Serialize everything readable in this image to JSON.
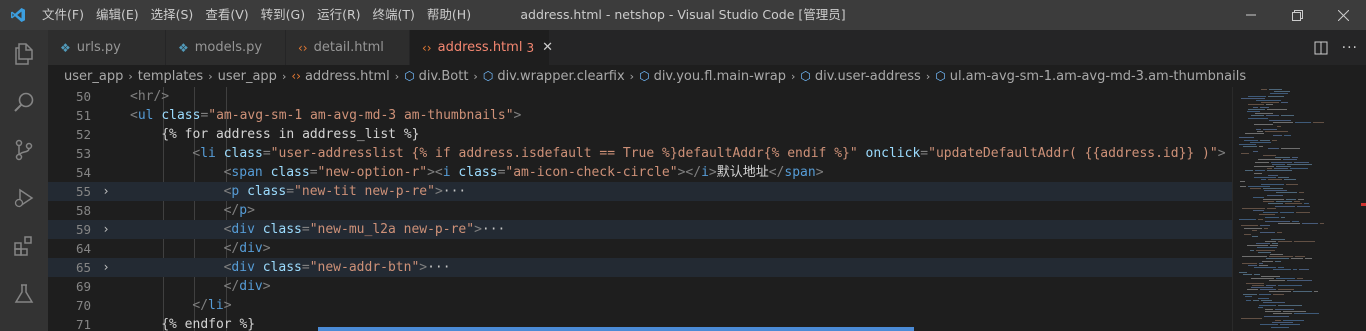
{
  "window": {
    "title": "address.html - netshop - Visual Studio Code [管理员]"
  },
  "menu": {
    "items": [
      "文件(F)",
      "编辑(E)",
      "选择(S)",
      "查看(V)",
      "转到(G)",
      "运行(R)",
      "终端(T)",
      "帮助(H)"
    ]
  },
  "activity": {
    "items": [
      "explorer-icon",
      "search-icon",
      "source-control-icon",
      "run-debug-icon",
      "extensions-icon",
      "testing-icon"
    ]
  },
  "tabs": [
    {
      "label": "urls.py",
      "icon": "python-file-icon"
    },
    {
      "label": "models.py",
      "icon": "python-file-icon"
    },
    {
      "label": "detail.html",
      "icon": "html-file-icon"
    },
    {
      "label": "address.html",
      "icon": "html-file-icon",
      "problems": "3",
      "active": true
    }
  ],
  "breadcrumb": {
    "folders": [
      "user_app",
      "templates",
      "user_app"
    ],
    "file": "address.html",
    "symbols": [
      "div.Bott",
      "div.wrapper.clearfix",
      "div.you.fl.main-wrap",
      "div.user-address",
      "ul.am-avg-sm-1.am-avg-md-3.am-thumbnails"
    ]
  },
  "editor": {
    "lines": [
      {
        "num": "50",
        "fold": "",
        "tokens": []
      },
      {
        "num": "51",
        "fold": "",
        "tokens": []
      },
      {
        "num": "52",
        "fold": "",
        "tokens": []
      },
      {
        "num": "53",
        "fold": "",
        "tokens": []
      },
      {
        "num": "54",
        "fold": "",
        "tokens": []
      },
      {
        "num": "55",
        "fold": "›",
        "tokens": []
      },
      {
        "num": "58",
        "fold": "",
        "tokens": []
      },
      {
        "num": "59",
        "fold": "›",
        "tokens": []
      },
      {
        "num": "64",
        "fold": "",
        "tokens": []
      },
      {
        "num": "65",
        "fold": "›",
        "tokens": []
      },
      {
        "num": "69",
        "fold": "",
        "tokens": []
      },
      {
        "num": "70",
        "fold": "",
        "tokens": []
      },
      {
        "num": "71",
        "fold": "",
        "tokens": []
      }
    ],
    "code": {
      "l50": "<hr/>",
      "l51": [
        "<",
        "ul",
        " ",
        "class",
        "=",
        "\"am-avg-sm-1 am-avg-md-3 am-thumbnails\"",
        ">"
      ],
      "l52": "{% for address in address_list %}",
      "l53": [
        "<",
        "li",
        " ",
        "class",
        "=",
        "\"user-addresslist {% if address.isdefault == True %}defaultAddr{% endif %}\"",
        " ",
        "onclick",
        "=",
        "\"updateDefaultAddr( {{address.id}} )\"",
        ">"
      ],
      "l54": [
        "<",
        "span",
        " ",
        "class",
        "=",
        "\"new-option-r\"",
        "><",
        "i",
        " ",
        "class",
        "=",
        "\"am-icon-check-circle\"",
        "></",
        "i",
        ">",
        "默认地址",
        "</",
        "span",
        ">"
      ],
      "l55": [
        "<",
        "p",
        " ",
        "class",
        "=",
        "\"new-tit new-p-re\"",
        ">",
        "···"
      ],
      "l58": [
        "</",
        "p",
        ">"
      ],
      "l59": [
        "<",
        "div",
        " ",
        "class",
        "=",
        "\"new-mu_l2a new-p-re\"",
        ">",
        "···"
      ],
      "l64": [
        "</",
        "div",
        ">"
      ],
      "l65": [
        "<",
        "div",
        " ",
        "class",
        "=",
        "\"new-addr-btn\"",
        ">",
        "···"
      ],
      "l69": [
        "</",
        "div",
        ">"
      ],
      "l70": [
        "</",
        "li",
        ">"
      ],
      "l71": "{% endfor %}"
    }
  },
  "colors": {
    "tag": "#569cd6",
    "attr": "#9cdcfe",
    "string": "#ce9178",
    "punctuation": "#808080",
    "text": "#d4d4d4",
    "modified_tab": "#f48771"
  }
}
